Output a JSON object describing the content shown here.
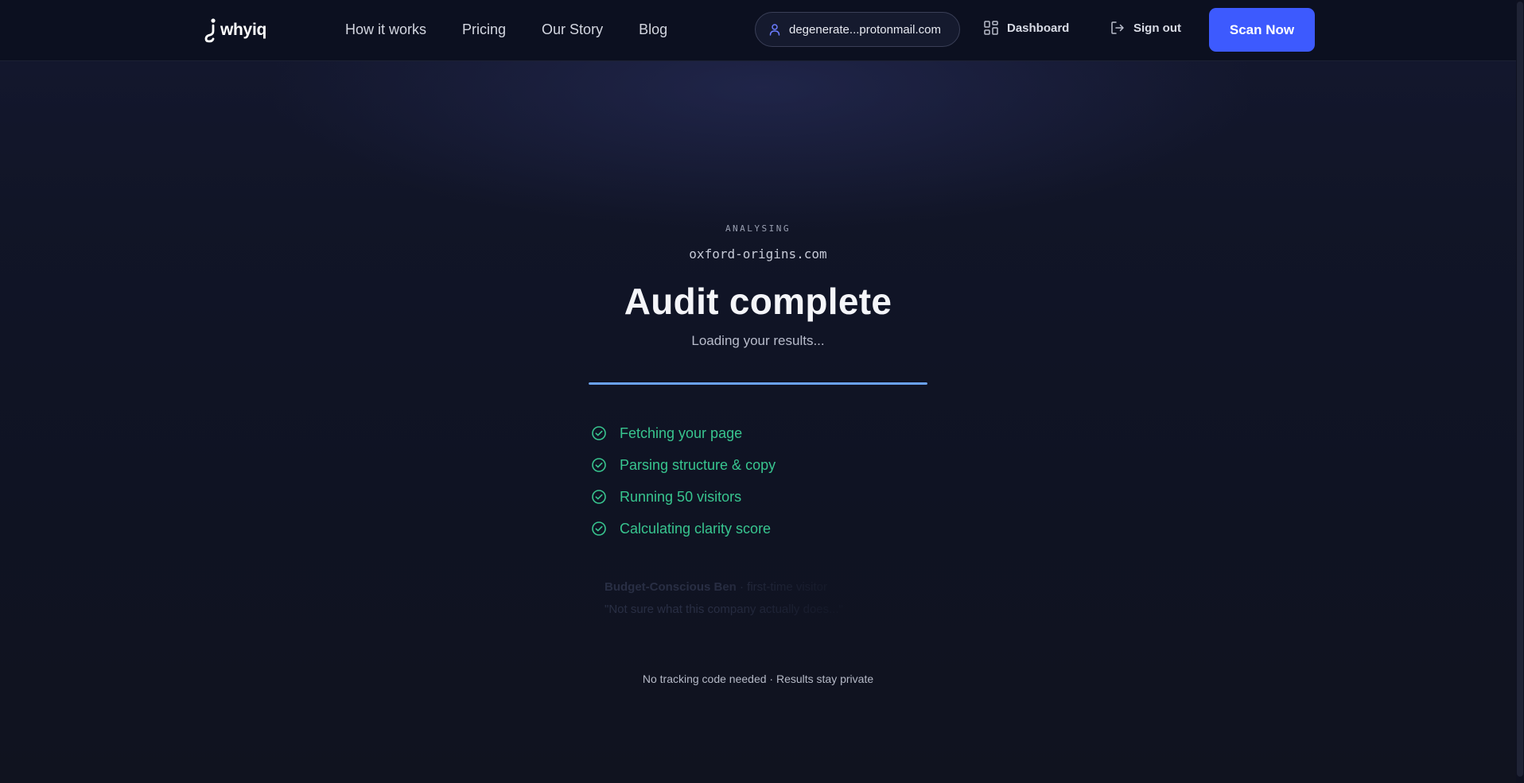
{
  "header": {
    "logo_text": "whyiq",
    "nav": [
      {
        "label": "How it works"
      },
      {
        "label": "Pricing"
      },
      {
        "label": "Our Story"
      },
      {
        "label": "Blog"
      }
    ],
    "user_email": "degenerate...protonmail.com",
    "dashboard_label": "Dashboard",
    "signout_label": "Sign out",
    "scan_label": "Scan Now"
  },
  "main": {
    "eyebrow": "ANALYSING",
    "domain": "oxford-origins.com",
    "title": "Audit complete",
    "subtitle": "Loading your results...",
    "progress_percent": 100,
    "steps": [
      {
        "label": "Fetching your page",
        "status": "done"
      },
      {
        "label": "Parsing structure & copy",
        "status": "done"
      },
      {
        "label": "Running 50 visitors",
        "status": "done"
      },
      {
        "label": "Calculating clarity score",
        "status": "done"
      }
    ],
    "ghost_text": {
      "line1_strong": "Budget-Conscious Ben",
      "line1_rest": "· first-time visitor",
      "line2": "\"Not sure what this company actually does...\""
    },
    "footnote": "No tracking code needed · Results stay private"
  },
  "colors": {
    "accent": "#3d5afe",
    "progress": "#6aa2f2",
    "success": "#38c58f",
    "background": "#0f1321"
  },
  "icons": {
    "user": "user-icon",
    "dashboard": "grid-icon",
    "signout": "logout-icon",
    "step_done": "check-circle-icon"
  }
}
